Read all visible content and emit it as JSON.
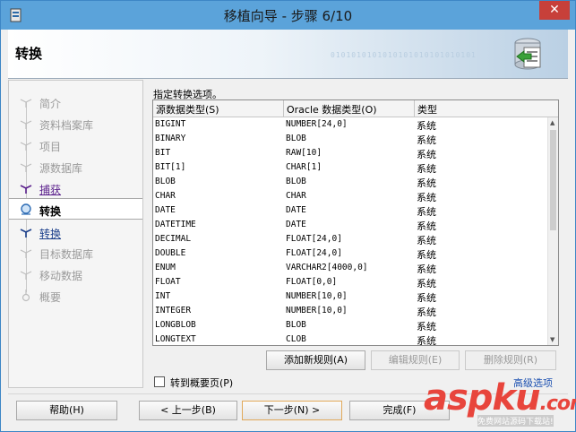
{
  "window": {
    "title": "移植向导 - 步骤 6/10",
    "close_glyph": "✕"
  },
  "banner": {
    "heading": "转换",
    "binary_text": "0101010101010101010101010101"
  },
  "nav": {
    "items": [
      {
        "label": "简介",
        "state": "done"
      },
      {
        "label": "资料档案库",
        "state": "done"
      },
      {
        "label": "项目",
        "state": "done"
      },
      {
        "label": "源数据库",
        "state": "done"
      },
      {
        "label": "捕获",
        "state": "link"
      },
      {
        "label": "转换",
        "state": "current"
      },
      {
        "label": "转换",
        "state": "link2"
      },
      {
        "label": "目标数据库",
        "state": "pending"
      },
      {
        "label": "移动数据",
        "state": "pending"
      },
      {
        "label": "概要",
        "state": "pending"
      }
    ]
  },
  "instruction": "指定转换选项。",
  "grid": {
    "headers": [
      "源数据类型(S)",
      "Oracle 数据类型(O)",
      "类型"
    ],
    "rows": [
      [
        "BIGINT",
        "NUMBER[24,0]",
        "系统"
      ],
      [
        "BINARY",
        "BLOB",
        "系统"
      ],
      [
        "BIT",
        "RAW[10]",
        "系统"
      ],
      [
        "BIT[1]",
        "CHAR[1]",
        "系统"
      ],
      [
        "BLOB",
        "BLOB",
        "系统"
      ],
      [
        "CHAR",
        "CHAR",
        "系统"
      ],
      [
        "DATE",
        "DATE",
        "系统"
      ],
      [
        "DATETIME",
        "DATE",
        "系统"
      ],
      [
        "DECIMAL",
        "FLOAT[24,0]",
        "系统"
      ],
      [
        "DOUBLE",
        "FLOAT[24,0]",
        "系统"
      ],
      [
        "ENUM",
        "VARCHAR2[4000,0]",
        "系统"
      ],
      [
        "FLOAT",
        "FLOAT[0,0]",
        "系统"
      ],
      [
        "INT",
        "NUMBER[10,0]",
        "系统"
      ],
      [
        "INTEGER",
        "NUMBER[10,0]",
        "系统"
      ],
      [
        "LONGBLOB",
        "BLOB",
        "系统"
      ],
      [
        "LONGTEXT",
        "CLOB",
        "系统"
      ]
    ]
  },
  "rule_buttons": {
    "add": "添加新规则(A)",
    "edit": "编辑规则(E)",
    "delete": "删除规则(R)"
  },
  "checkbox": {
    "label": "转到概要页(P)",
    "checked": false
  },
  "advanced_link": "高级选项",
  "footer": {
    "help": "帮助(H)",
    "back": "< 上一步(B)",
    "next": "下一步(N) >",
    "finish": "完成(F)"
  },
  "watermark": {
    "brand": "aspku",
    "tld": ".com",
    "tagline": "免费网站源码下载站!"
  },
  "colors": {
    "titlebar": "#5ba3da",
    "close": "#c7403a",
    "link": "#1a4fb0",
    "visited": "#5a1f8c"
  }
}
